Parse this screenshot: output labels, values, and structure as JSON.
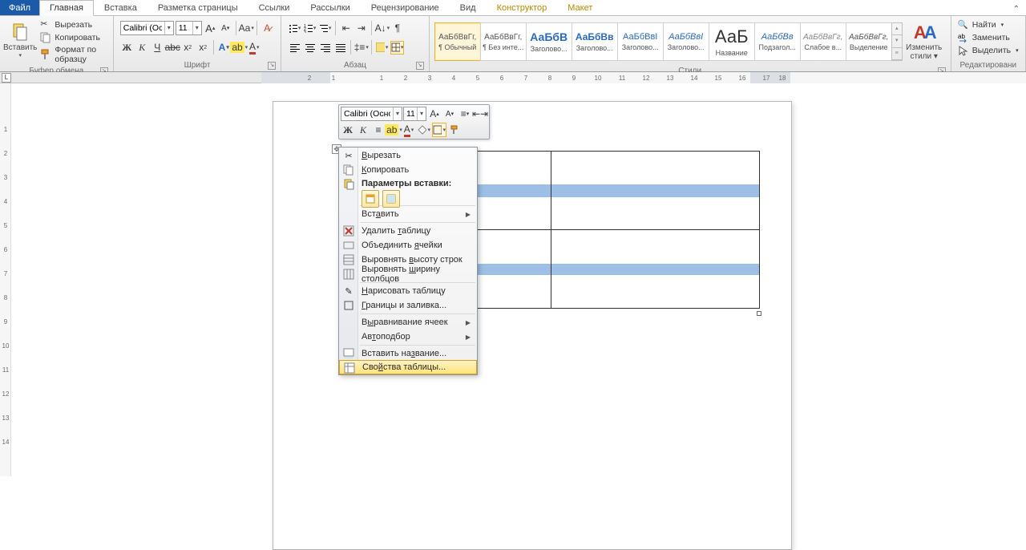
{
  "tabs": {
    "file": "Файл",
    "home": "Главная",
    "insert": "Вставка",
    "layout": "Разметка страницы",
    "refs": "Ссылки",
    "mail": "Рассылки",
    "review": "Рецензирование",
    "view": "Вид",
    "design": "Конструктор",
    "tlayout": "Макет"
  },
  "ribbon": {
    "clipboard": {
      "paste": "Вставить",
      "cut": "Вырезать",
      "copy": "Копировать",
      "fmt": "Формат по образцу",
      "label": "Буфер обмена"
    },
    "font": {
      "name": "Calibri (Осно",
      "size": "11",
      "label": "Шрифт"
    },
    "para": {
      "label": "Абзац"
    },
    "styles": {
      "label": "Стили",
      "change": "Изменить стили",
      "items": [
        {
          "sample": "АаБбВвГг,",
          "name": "¶ Обычный",
          "sel": true,
          "cls": ""
        },
        {
          "sample": "АаБбВвГг,",
          "name": "¶ Без инте...",
          "sel": false,
          "cls": ""
        },
        {
          "sample": "АаБбВ",
          "name": "Заголово...",
          "sel": false,
          "cls": "c1"
        },
        {
          "sample": "АаБбВв",
          "name": "Заголово...",
          "sel": false,
          "cls": "c2"
        },
        {
          "sample": "АаБбВвІ",
          "name": "Заголово...",
          "sel": false,
          "cls": "c3"
        },
        {
          "sample": "АаБбВвІ",
          "name": "Заголово...",
          "sel": false,
          "cls": "c4"
        },
        {
          "sample": "АаБ",
          "name": "Название",
          "sel": false,
          "cls": "big"
        },
        {
          "sample": "АаБбВв",
          "name": "Подзагол...",
          "sel": false,
          "cls": "c5"
        },
        {
          "sample": "АаБбВвГг,",
          "name": "Слабое в...",
          "sel": false,
          "cls": "c6"
        },
        {
          "sample": "АаБбВвГг,",
          "name": "Выделение",
          "sel": false,
          "cls": "c7"
        }
      ]
    },
    "editing": {
      "find": "Найти",
      "replace": "Заменить",
      "select": "Выделить",
      "label": "Редактировани"
    }
  },
  "mini": {
    "font": "Calibri (Основ",
    "size": "11"
  },
  "ctx": {
    "cut": "Вырезать",
    "copy": "Копировать",
    "pasteopts": "Параметры вставки:",
    "insert": "Вставить",
    "deltable": "Удалить таблицу",
    "merge": "Объединить ячейки",
    "roweq": "Выровнять высоту строк",
    "coleq": "Выровнять ширину столбцов",
    "draw": "Нарисовать таблицу",
    "borders": "Границы и заливка...",
    "align": "Выравнивание ячеек",
    "autofit": "Автоподбор",
    "caption": "Вставить название...",
    "props": "Свойства таблицы..."
  }
}
